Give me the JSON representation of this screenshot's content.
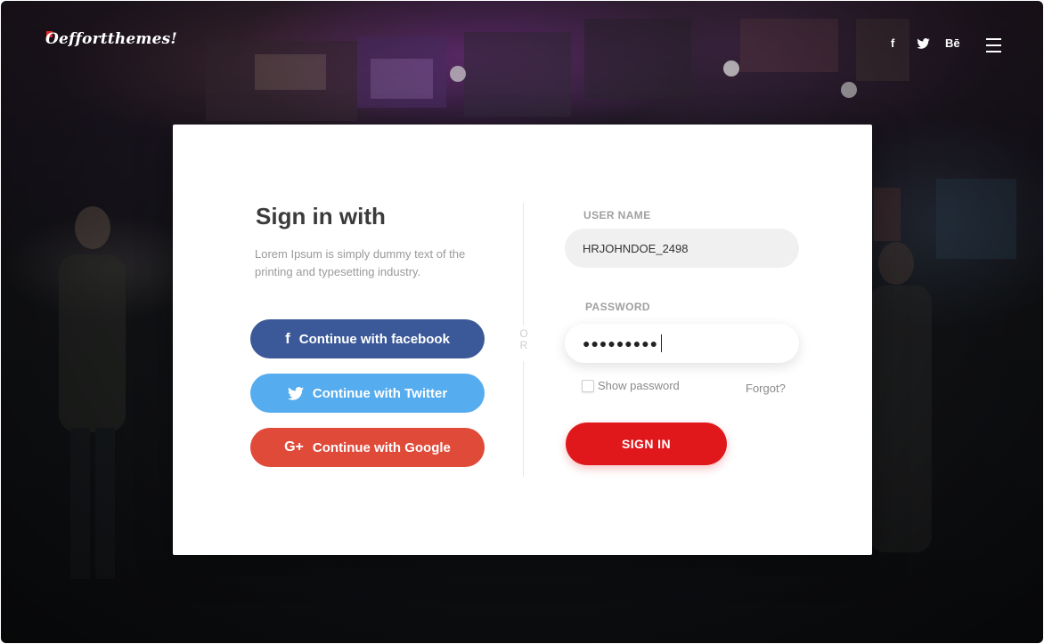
{
  "brand": {
    "logo_text": "Oeffortthemes!"
  },
  "header": {
    "social": {
      "facebook": "f",
      "twitter_icon": "twitter-bird-icon",
      "behance": "Bē"
    },
    "menu_icon": "hamburger-menu-icon"
  },
  "card": {
    "title": "Sign in with",
    "subtitle": "Lorem Ipsum is simply dummy text of the printing and typesetting industry.",
    "buttons": {
      "facebook": {
        "label": "Continue with facebook",
        "icon_glyph": "f",
        "color": "#3b5998"
      },
      "twitter": {
        "label": "Continue with Twitter",
        "color": "#55acee"
      },
      "google": {
        "label": "Continue with Google",
        "icon_glyph": "G+",
        "color": "#e04a39"
      }
    },
    "or_text": "OR",
    "form": {
      "username_label": "USER NAME",
      "username_value": "HRJOHNDOE_2498",
      "password_label": "PASSWORD",
      "password_masked": "●●●●●●●●●",
      "show_password_label": "Show password",
      "show_password_checked": false,
      "forgot_label": "Forgot?",
      "submit_label": "SIGN IN",
      "submit_color": "#e0181c"
    }
  }
}
